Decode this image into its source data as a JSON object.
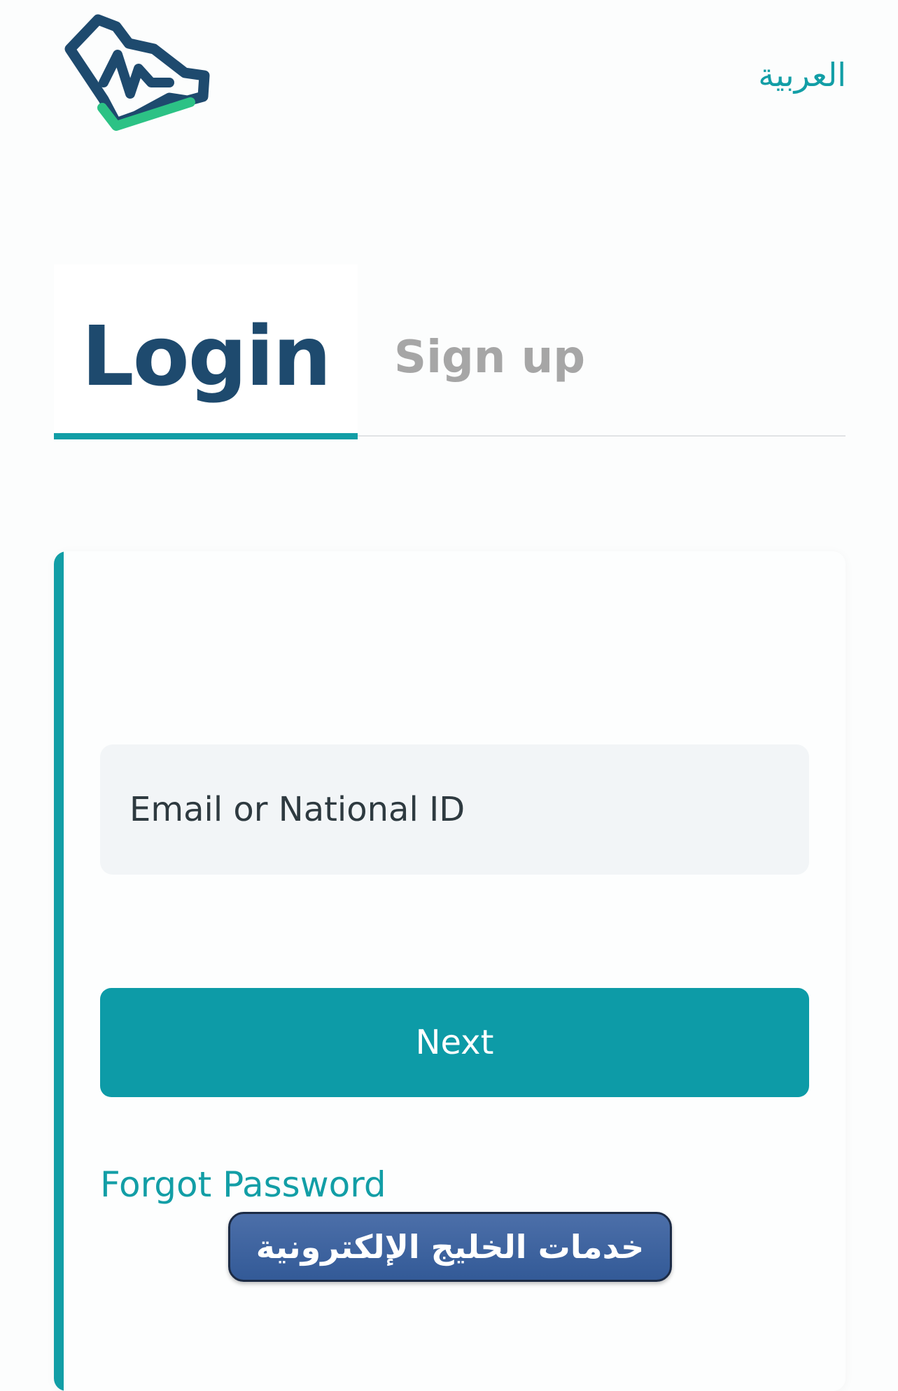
{
  "header": {
    "logo_icon": "heartbeat-map-logo",
    "language_link": "العربية"
  },
  "tabs": [
    {
      "label": "Login",
      "active": true
    },
    {
      "label": "Sign up",
      "active": false
    }
  ],
  "login_form": {
    "identifier_placeholder": "Email or National ID",
    "identifier_value": "",
    "next_label": "Next",
    "forgot_password_label": "Forgot Password"
  },
  "watermark": {
    "text": "خدمات الخليج الإلكترونية"
  },
  "colors": {
    "accent": "#129ea6",
    "brand_navy": "#1e4a6e",
    "logo_green": "#2cc285",
    "button": "#0d9ba7",
    "input_bg": "#f2f5f7",
    "inactive_tab": "#a6a6a6"
  }
}
